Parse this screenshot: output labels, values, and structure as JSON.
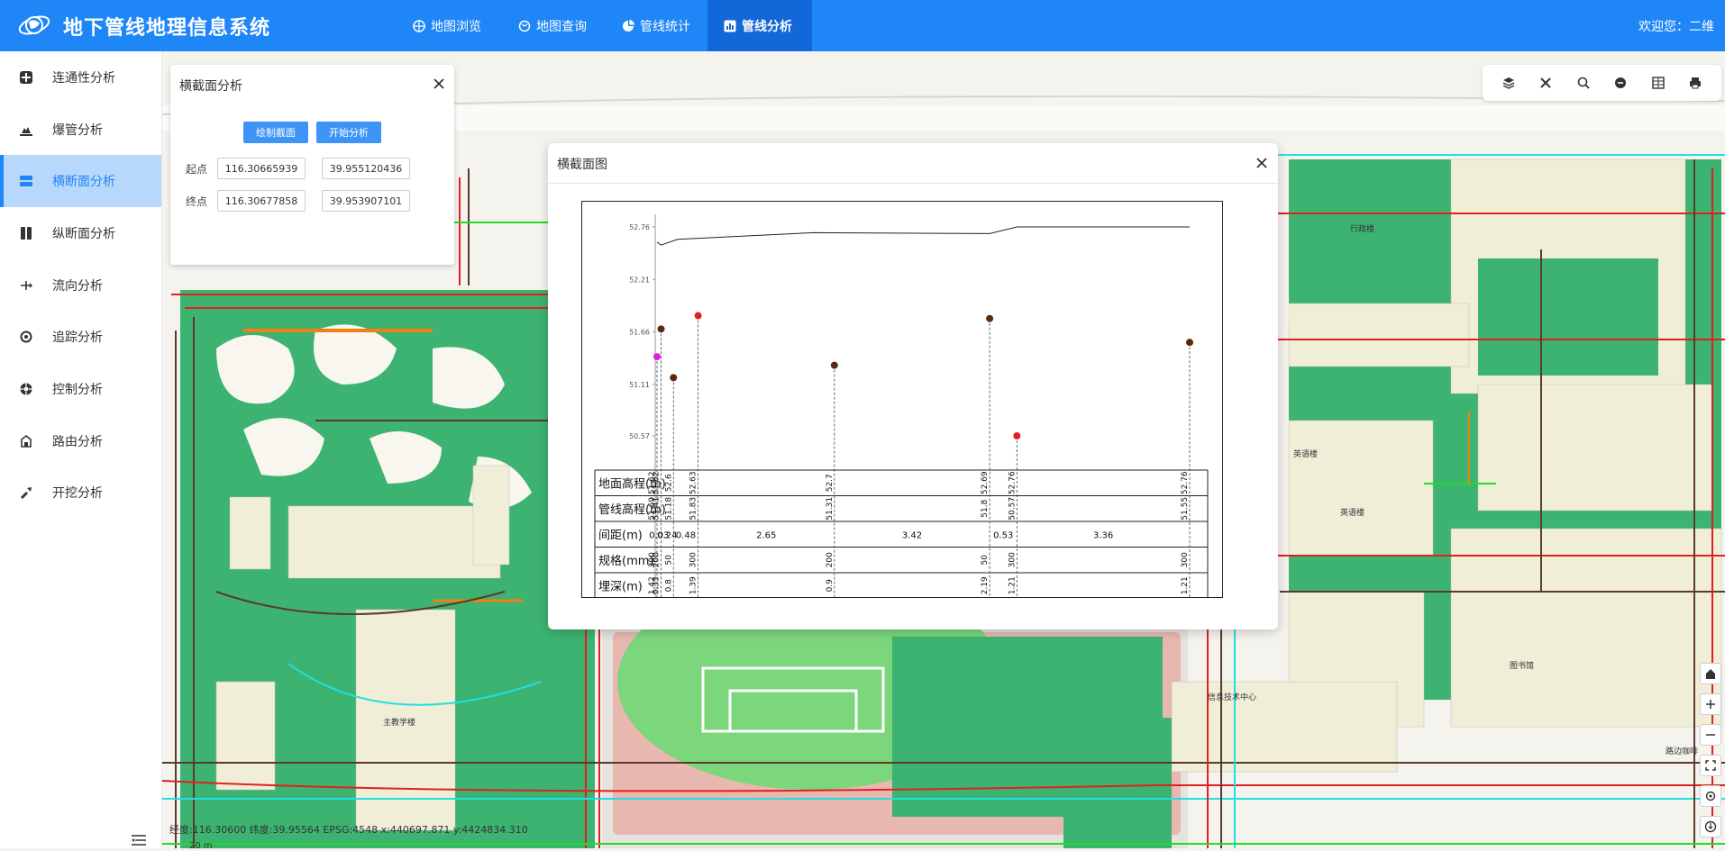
{
  "app": {
    "title": "地下管线地理信息系统",
    "welcome": "欢迎您：二维"
  },
  "nav": [
    {
      "label": "地图浏览",
      "icon": "globe-icon"
    },
    {
      "label": "地图查询",
      "icon": "map-search-icon"
    },
    {
      "label": "管线统计",
      "icon": "pie-chart-icon"
    },
    {
      "label": "管线分析",
      "icon": "bar-chart-icon",
      "active": true
    }
  ],
  "sidebar": [
    {
      "label": "连通性分析",
      "icon": "connectivity-icon"
    },
    {
      "label": "爆管分析",
      "icon": "burst-pipe-icon"
    },
    {
      "label": "横断面分析",
      "icon": "cross-section-icon",
      "active": true
    },
    {
      "label": "纵断面分析",
      "icon": "profile-icon"
    },
    {
      "label": "流向分析",
      "icon": "flow-icon"
    },
    {
      "label": "追踪分析",
      "icon": "trace-icon"
    },
    {
      "label": "控制分析",
      "icon": "control-icon"
    },
    {
      "label": "路由分析",
      "icon": "route-icon"
    },
    {
      "label": "开挖分析",
      "icon": "excavation-icon"
    }
  ],
  "panel": {
    "title": "横截面分析",
    "draw_button": "绘制截面",
    "start_button": "开始分析",
    "start_label": "起点",
    "end_label": "终点",
    "start_lon": "116.30665939",
    "start_lat": "39.955120436",
    "end_lon": "116.30677858",
    "end_lat": "39.953907101"
  },
  "dialog": {
    "title": "横截面图"
  },
  "status": {
    "coords": "经度:116.30600 纬度:39.95564    EPSG:4548  x:440697.871  y:4424834.310",
    "scale": "20 m"
  },
  "colors": {
    "topbar": "#1e86f7",
    "active_tab": "#1268d9",
    "sidebar_active": "#b8d8fb",
    "green": "#3cb371",
    "building": "#f1eed8",
    "pipe_red": "#e02020",
    "pipe_brown": "#5a3a2a",
    "pipe_cyan": "#22e0e0",
    "pipe_green": "#22dd22",
    "pipe_orange": "#f08010"
  },
  "chart_data": {
    "type": "scatter",
    "title": "",
    "y_ticks": [
      "52.76",
      "52.21",
      "51.66",
      "51.11",
      "50.57"
    ],
    "ylim": [
      50.57,
      52.76
    ],
    "row_labels": [
      "地面高程(m)",
      "管线高程(m)",
      "间距(m)",
      "规格(mm)",
      "埋深(m)"
    ],
    "ground_line": [
      [
        0,
        52.6
      ],
      [
        0.08,
        52.57
      ],
      [
        0.4,
        52.63
      ],
      [
        3.05,
        52.7
      ],
      [
        6.47,
        52.69
      ],
      [
        7.0,
        52.76
      ],
      [
        10.36,
        52.76
      ]
    ],
    "points": [
      {
        "x": 0.08,
        "pipe_elev": 51.69,
        "color": "#5a2a0a"
      },
      {
        "x": 0.0,
        "pipe_elev": 51.4,
        "color": "#e020e0"
      },
      {
        "x": 0.32,
        "pipe_elev": 51.18,
        "color": "#5a2a0a"
      },
      {
        "x": 0.8,
        "pipe_elev": 51.83,
        "color": "#e02020"
      },
      {
        "x": 3.45,
        "pipe_elev": 51.31,
        "color": "#5a2a0a"
      },
      {
        "x": 6.47,
        "pipe_elev": 51.8,
        "color": "#5a2a0a"
      },
      {
        "x": 7.0,
        "pipe_elev": 50.57,
        "color": "#e02020"
      },
      {
        "x": 10.36,
        "pipe_elev": 51.55,
        "color": "#5a2a0a"
      }
    ],
    "ground_row": [
      "51.62",
      "51.62",
      "52.6",
      "52.63",
      "52.7",
      "52.69",
      "52.76",
      "52.76"
    ],
    "pipe_row": [
      "51.41",
      "51.69",
      "51.18",
      "51.83",
      "51.31",
      "51.8",
      "50.57",
      "51.55"
    ],
    "spacing_row": [
      "0.03",
      "0.24",
      "0.48",
      "2.65",
      "3.42",
      "0.53",
      "3.36"
    ],
    "spec_row": [
      "200",
      "300",
      "50",
      "300",
      "200",
      "50",
      "300"
    ],
    "depth_row": [
      "0.33",
      "1.42",
      "0.8",
      "1.39",
      "0.9",
      "2.19",
      "1.21"
    ]
  },
  "tools": [
    "layers-icon",
    "measure-icon",
    "search-area-icon",
    "clear-icon",
    "table-icon",
    "print-icon"
  ],
  "zoom_controls": [
    "home-icon",
    "zoom-in-icon",
    "zoom-out-icon",
    "fullscreen-icon",
    "locate-icon",
    "compass-icon"
  ],
  "map_labels": [
    "行政楼",
    "英语楼",
    "英语楼",
    "图书馆",
    "信息技术中心",
    "主教学楼",
    "路边咖啡"
  ]
}
